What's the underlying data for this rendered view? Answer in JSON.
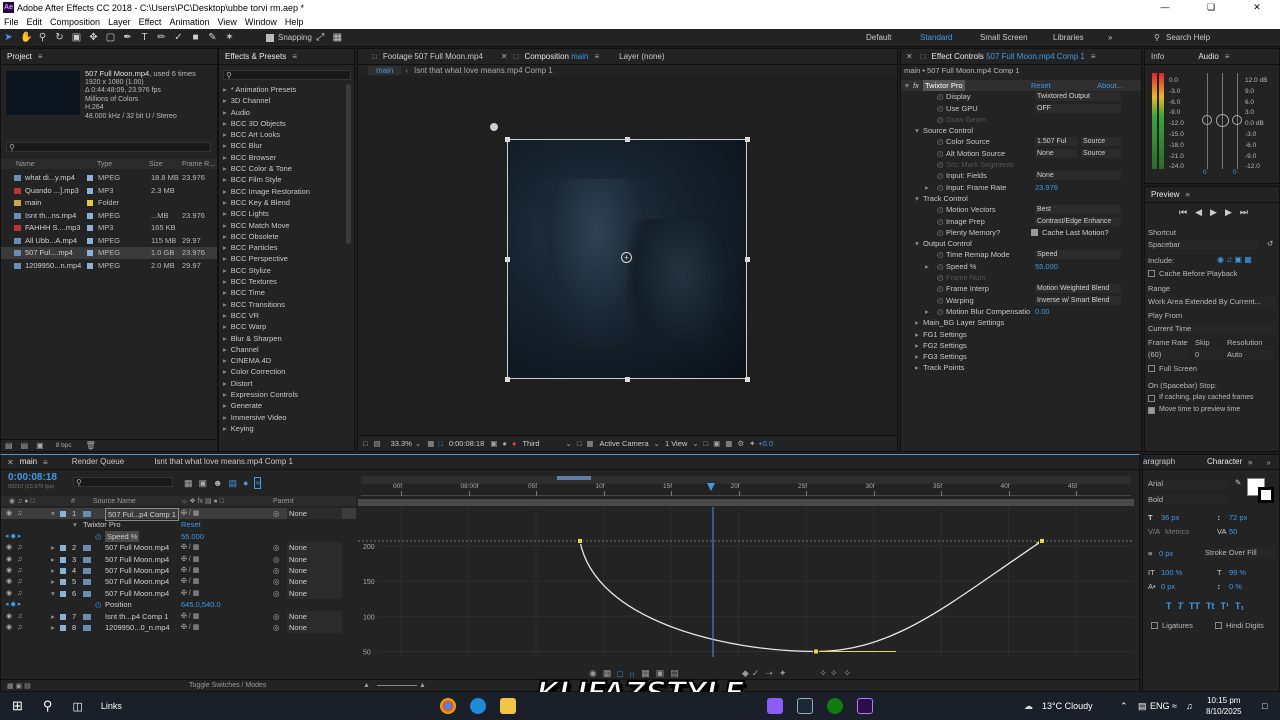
{
  "titlebar": {
    "title": "Adobe After Effects CC 2018 - C:\\Users\\PC\\Desktop\\ubbe torvi rm.aep *"
  },
  "menu": [
    "File",
    "Edit",
    "Composition",
    "Layer",
    "Effect",
    "Animation",
    "View",
    "Window",
    "Help"
  ],
  "toolbar": {
    "snapping": "Snapping",
    "workspaces": [
      "Default",
      "Standard",
      "Small Screen",
      "Libraries"
    ],
    "search_placeholder": "Search Help"
  },
  "project": {
    "tab": "Project",
    "item_name": "507 Full Moon.mp4",
    "item_used": ", used 6 times",
    "item_info": [
      "1920 x 1080 (1.00)",
      "Δ 0:44:48:09, 23.976 fps",
      "Millions of Colors",
      "H.264",
      "48.000 kHz / 32 bit U / Stereo"
    ],
    "columns": [
      "Name",
      "Type",
      "Size",
      "Frame R..."
    ],
    "files": [
      {
        "name": "what di...y.mp4",
        "type": "MPEG",
        "size": "18.8 MB",
        "rate": "23.976",
        "color": "#5aa0c8"
      },
      {
        "name": "Quando ...].mp3",
        "type": "MP3",
        "size": "2.3 MB",
        "rate": "",
        "color": "#5aa0c8"
      },
      {
        "name": "main",
        "type": "Folder",
        "size": "",
        "rate": "",
        "color": "#e3c84c"
      },
      {
        "name": "Isnt th...ns.mp4",
        "type": "MPEG",
        "size": "...MB",
        "rate": "23.976",
        "color": "#5aa0c8"
      },
      {
        "name": "FAHHH S....mp3",
        "type": "MP3",
        "size": "165 KB",
        "rate": "",
        "color": "#5aa0c8"
      },
      {
        "name": "All Ubb...A.mp4",
        "type": "MPEG",
        "size": "115 MB",
        "rate": "29.97",
        "color": "#5aa0c8"
      },
      {
        "name": "507 Ful....mp4",
        "type": "MPEG",
        "size": "1.0 GB",
        "rate": "23.976",
        "color": "#5aa0c8"
      },
      {
        "name": "1209950...n.mp4",
        "type": "MPEG",
        "size": "2.0 MB",
        "rate": "29.97",
        "color": "#5aa0c8"
      }
    ],
    "bpc": "8 bpc"
  },
  "effects": {
    "tab": "Effects & Presets",
    "items": [
      "* Animation Presets",
      "3D Channel",
      "Audio",
      "BCC 3D Objects",
      "BCC Art Looks",
      "BCC Blur",
      "BCC Browser",
      "BCC Color & Tone",
      "BCC Film Style",
      "BCC Image Restoration",
      "BCC Key & Blend",
      "BCC Lights",
      "BCC Match Move",
      "BCC Obsolete",
      "BCC Particles",
      "BCC Perspective",
      "BCC Stylize",
      "BCC Textures",
      "BCC Time",
      "BCC Transitions",
      "BCC VR",
      "BCC Warp",
      "Blur & Sharpen",
      "Channel",
      "CINEMA 4D",
      "Color Correction",
      "Distort",
      "Expression Controls",
      "Generate",
      "Immersive Video",
      "Keying"
    ]
  },
  "viewer": {
    "tabs": [
      "Footage 507 Full Moon.mp4",
      "Composition main",
      "Layer (none)"
    ],
    "subtabs": [
      "main",
      "Isnt that what love means.mp4 Comp 1"
    ],
    "zoom": "33.3%",
    "timecode": "0:00:08:18",
    "resolution": "Third",
    "camera": "Active Camera",
    "views": "1 View",
    "exposure": "+0.0"
  },
  "effect_controls": {
    "tab": "Effect Controls 507 Full Moon.mp4 Comp 1",
    "path": "main • 507 Full Moon.mp4 Comp 1",
    "rows": [
      {
        "label": "Twixtor Pro",
        "value": "Reset",
        "extra": "About...",
        "indent": 0
      },
      {
        "label": "Display",
        "value": "Twixtored Output",
        "indent": 2
      },
      {
        "label": "Use GPU",
        "value": "OFF",
        "indent": 2
      },
      {
        "label": "Draw Geom",
        "value": "",
        "indent": 2,
        "dim": true
      },
      {
        "label": "Source Control",
        "value": "",
        "indent": 1
      },
      {
        "label": "Color Source",
        "value": "1.507 Ful",
        "extra": "Source",
        "indent": 2
      },
      {
        "label": "Alt Motion Source",
        "value": "None",
        "extra": "Source",
        "indent": 2
      },
      {
        "label": "Src: Mark Segments",
        "value": "",
        "indent": 2,
        "dim": true
      },
      {
        "label": "Input: Fields",
        "value": "None",
        "indent": 2
      },
      {
        "label": "Input: Frame Rate",
        "value": "23.976",
        "indent": 2,
        "blue": true
      },
      {
        "label": "Track Control",
        "value": "",
        "indent": 1
      },
      {
        "label": "Motion Vectors",
        "value": "Best",
        "indent": 2
      },
      {
        "label": "Image Prep",
        "value": "Contrast/Edge Enhance",
        "indent": 2
      },
      {
        "label": "Plenty Memory?",
        "value": "Cache Last Motion?",
        "indent": 2
      },
      {
        "label": "Output Control",
        "value": "",
        "indent": 1
      },
      {
        "label": "Time Remap Mode",
        "value": "Speed",
        "indent": 2
      },
      {
        "label": "Speed %",
        "value": "55.000",
        "indent": 2,
        "blue": true
      },
      {
        "label": "Frame Num",
        "value": "",
        "indent": 2,
        "dim": true
      },
      {
        "label": "Frame Interp",
        "value": "Motion Weighted Blend",
        "indent": 2
      },
      {
        "label": "Warping",
        "value": "Inverse w/ Smart Blend",
        "indent": 2
      },
      {
        "label": "Motion Blur Compensatio",
        "value": "0.00",
        "indent": 2,
        "blue": true
      },
      {
        "label": "Main_BG Layer Settings",
        "value": "",
        "indent": 1
      },
      {
        "label": "FG1 Settings",
        "value": "",
        "indent": 1
      },
      {
        "label": "FG2 Settings",
        "value": "",
        "indent": 1
      },
      {
        "label": "FG3 Settings",
        "value": "",
        "indent": 1
      },
      {
        "label": "Track Points",
        "value": "",
        "indent": 1
      }
    ]
  },
  "info_audio": {
    "tabs": [
      "Info",
      "Audio"
    ],
    "left_scale": [
      "0.0",
      "-3.0",
      "-6.0",
      "-9.0",
      "-12.0",
      "-15.0",
      "-18.0",
      "-21.0",
      "-24.0"
    ],
    "right_scale": [
      "12.0 dB",
      "9.0",
      "6.0",
      "3.0",
      "0.0 dB",
      "-3.0",
      "-6.0",
      "-9.0",
      "-12.0"
    ],
    "zero_left": "0",
    "zero_right": "0"
  },
  "preview": {
    "tab": "Preview",
    "shortcut_label": "Shortcut",
    "shortcut": "Spacebar",
    "include": "Include:",
    "cache": "Cache Before Playback",
    "range_label": "Range",
    "range": "Work Area Extended By Current...",
    "playfrom_label": "Play From",
    "playfrom": "Current Time",
    "framerate_label": "Frame Rate",
    "skip_label": "Skip",
    "resolution_label": "Resolution",
    "framerate": "(60)",
    "skip": "0",
    "resolution": "Auto",
    "fullscreen": "Full Screen",
    "stop_label": "On (Spacebar) Stop:",
    "stop1": "If caching, play cached frames",
    "stop2": "Move time to preview time"
  },
  "character": {
    "tabs": [
      "aragraph",
      "Character"
    ],
    "font": "Arial",
    "style": "Bold",
    "size": "36 px",
    "leading": "72 px",
    "kerning": "Metrics",
    "tracking": "50",
    "stroke": "0 px",
    "stroke_mode": "Stroke Over Fill",
    "vscale": "100 %",
    "hscale": "99 %",
    "baseline": "0 px",
    "tsume": "0 %",
    "ligatures": "Ligatures",
    "hindi": "Hindi Digits"
  },
  "timeline": {
    "tabs": [
      "main",
      "Render Queue",
      "Isnt that what love means.mp4 Comp 1"
    ],
    "timecode": "0:00:08:18",
    "timecode_sub": "00210 (23.976 fps)",
    "columns": [
      "#",
      "Source Name",
      "Parent"
    ],
    "layers": [
      {
        "num": "1",
        "name": "507 Ful...p4 Comp 1",
        "parent": "None",
        "selected": true
      },
      {
        "num": "",
        "name": "Twixtor Pro",
        "parent": "Reset",
        "effect": true
      },
      {
        "num": "",
        "name": "Speed %",
        "parent": "55.000",
        "prop": true
      },
      {
        "num": "2",
        "name": "507 Full Moon.mp4",
        "parent": "None"
      },
      {
        "num": "3",
        "name": "507 Full Moon.mp4",
        "parent": "None"
      },
      {
        "num": "4",
        "name": "507 Full Moon.mp4",
        "parent": "None"
      },
      {
        "num": "5",
        "name": "507 Full Moon.mp4",
        "parent": "None"
      },
      {
        "num": "6",
        "name": "507 Full Moon.mp4",
        "parent": "None"
      },
      {
        "num": "",
        "name": "Position",
        "parent": "645.0,540.0",
        "prop": true
      },
      {
        "num": "7",
        "name": "Isnt th...p4 Comp 1",
        "parent": "None"
      },
      {
        "num": "8",
        "name": "1209950...0_n.mp4",
        "parent": "None"
      }
    ],
    "ruler": [
      "00f",
      "08:00f",
      "05f",
      "10f",
      "15f",
      "20f",
      "25f",
      "30f",
      "35f",
      "40f",
      "45f"
    ],
    "graph_y": [
      "200",
      "150",
      "100",
      "50"
    ],
    "toggle": "Toggle Switches / Modes",
    "graph_keys": [
      {
        "t": 0.1,
        "v": 207
      },
      {
        "t": 0.5,
        "v": 50
      },
      {
        "t": 0.9,
        "v": 207
      }
    ]
  },
  "taskbar": {
    "links": "Links",
    "weather": "13°C Cloudy",
    "lang": "ENG",
    "time": "10:15 pm",
    "date": "8/10/2025",
    "watermark": "KLIFAZSTYLE"
  }
}
